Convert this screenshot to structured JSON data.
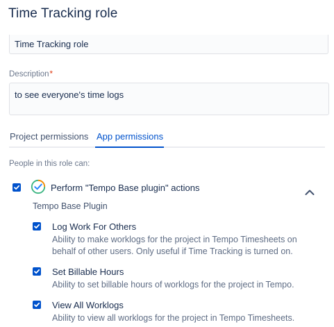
{
  "header": {
    "title": "Time Tracking role"
  },
  "form": {
    "name_value": "Time Tracking role",
    "description_label": "Description",
    "required_marker": "*",
    "description_value": "to see everyone's time logs"
  },
  "tabs": [
    {
      "label": "Project permissions",
      "active": false
    },
    {
      "label": "App permissions",
      "active": true
    }
  ],
  "permissions": {
    "intro": "People in this role can:",
    "app": {
      "title": "Perform \"Tempo Base plugin\" actions",
      "plugin_name": "Tempo Base Plugin",
      "checked": true,
      "icon": "tempo-check-icon",
      "expanded_icon": "chevron-up-icon"
    },
    "items": [
      {
        "title": "Log Work For Others",
        "description_line1": "Ability to make worklogs for the project in Tempo Timesheets on",
        "description_line2": "behalf of other users. Only useful if Time Tracking is turned on.",
        "checked": true
      },
      {
        "title": "Set Billable Hours",
        "description_line1": "Ability to set billable hours of worklogs for the project in Tempo.",
        "checked": true
      },
      {
        "title": "View All Worklogs",
        "description_line1": "Ability to view all worklogs for the project in Tempo Timesheets.",
        "checked": true
      }
    ]
  },
  "colors": {
    "accent": "#0052cc",
    "text": "#172b4d",
    "subtle_text": "#6b778c",
    "required": "#de350b",
    "tempo_green": "#36b37e",
    "tempo_orange": "#ff8b00"
  }
}
